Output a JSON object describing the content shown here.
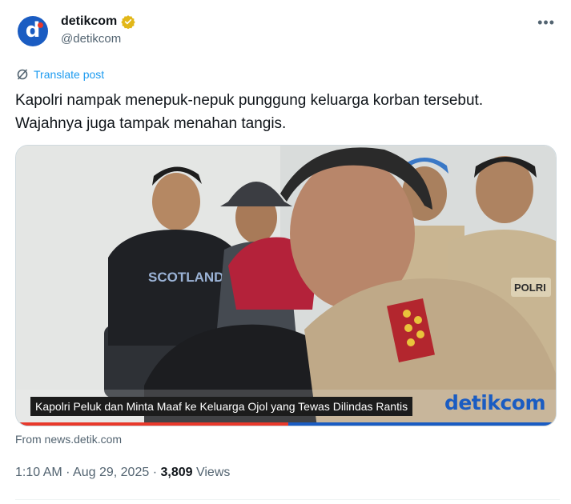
{
  "author": {
    "display_name": "detikcom",
    "handle": "@detikcom",
    "avatar_letter": "d",
    "verified_color": "#e2b719"
  },
  "translate_label": "Translate post",
  "tweet_text": {
    "line1": "Kapolri nampak menepuk-nepuk punggung keluarga korban tersebut.",
    "line2": "Wajahnya juga tampak menahan tangis."
  },
  "media": {
    "caption": "Kapolri Peluk dan Minta Maaf ke Keluarga Ojol yang Tewas Dilindas Rantis",
    "watermark": "detikcom",
    "shirt_text": "SCOTLAND",
    "badge_text": "POLRI"
  },
  "link_source": "From news.detik.com",
  "meta": {
    "time": "1:10 AM",
    "date": "Aug 29, 2025",
    "views_count": "3,809",
    "views_label": "Views"
  },
  "colors": {
    "accent": "#1d9bf0",
    "brand": "#1a5cc2",
    "muted": "#536471"
  }
}
